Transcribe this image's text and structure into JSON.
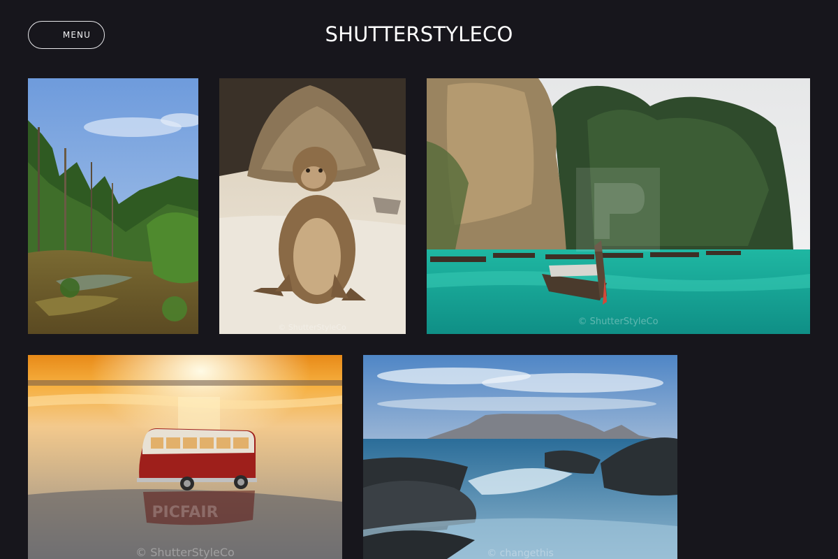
{
  "header": {
    "menu_label": "MENU",
    "site_title": "SHUTTERSTYLECO"
  },
  "gallery": {
    "photos": [
      {
        "subject": "jungle-swamp",
        "watermark": ""
      },
      {
        "subject": "monkey-on-beach",
        "watermark": "© ShutterStyleCo"
      },
      {
        "subject": "limestone-cliffs-longtail-boats",
        "watermark": "© ShutterStyleCo"
      },
      {
        "subject": "toy-van-sunset",
        "watermark": "© ShutterStyleCo"
      },
      {
        "subject": "table-mountain-coast",
        "watermark": "© changethis"
      }
    ],
    "wm_brand_text": "PICFAIR"
  },
  "colors": {
    "background": "#17161c",
    "text": "#ffffff"
  }
}
